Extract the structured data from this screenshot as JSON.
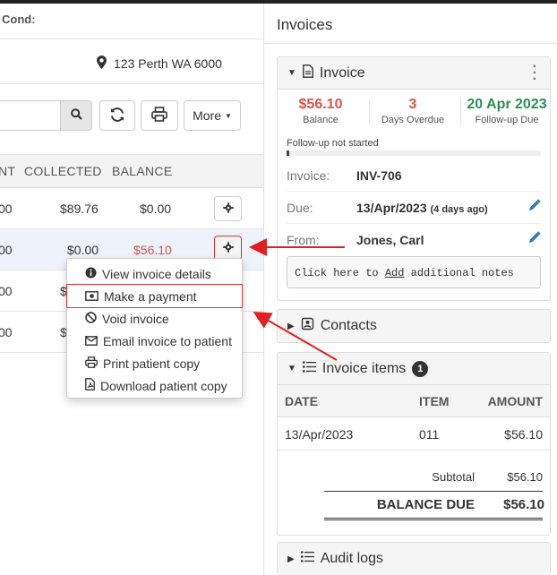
{
  "left": {
    "header_label": "Cond:",
    "address": "123 Perth WA 6000",
    "more_label": "More",
    "columns": [
      "NT",
      "COLLECTED",
      "BALANCE"
    ],
    "rows": [
      {
        "amount": "00",
        "collected": "$89.76",
        "balance": "$0.00"
      },
      {
        "amount": "00",
        "collected": "$0.00",
        "balance": "$56.10"
      },
      {
        "amount": "00",
        "collected": "$",
        "balance": ""
      },
      {
        "amount": "00",
        "collected": "$",
        "balance": ""
      }
    ]
  },
  "menu": {
    "items": [
      {
        "label": "View invoice details",
        "icon": "info-circle-icon"
      },
      {
        "label": "Make a payment",
        "icon": "money-icon"
      },
      {
        "label": "Void invoice",
        "icon": "ban-icon"
      },
      {
        "label": "Email invoice to patient",
        "icon": "envelope-icon"
      },
      {
        "label": "Print patient copy",
        "icon": "print-icon"
      },
      {
        "label": "Download patient copy",
        "icon": "pdf-file-icon"
      }
    ]
  },
  "right": {
    "title": "Invoices",
    "invoice_panel": {
      "title": "Invoice",
      "balance_value": "$56.10",
      "balance_label": "Balance",
      "overdue_value": "3",
      "overdue_label": "Days Overdue",
      "followup_value": "20 Apr 2023",
      "followup_label": "Follow-up Due",
      "followup_status": "Follow-up not started",
      "followup_progress": 0.01,
      "invoice_label": "Invoice:",
      "invoice_value": "INV-706",
      "due_label": "Due:",
      "due_value": "13/Apr/2023",
      "due_note": "(4 days ago)",
      "from_label": "From:",
      "from_value": "Jones, Carl",
      "notes_prefix": "Click here to ",
      "notes_link": "Add",
      "notes_suffix": " additional notes"
    },
    "contacts_title": "Contacts",
    "items_panel": {
      "title": "Invoice items",
      "count": "1",
      "columns": {
        "date": "DATE",
        "item": "ITEM",
        "amount": "AMOUNT"
      },
      "row": {
        "date": "13/Apr/2023",
        "item": "011",
        "amount": "$56.10"
      },
      "subtotal_label": "Subtotal",
      "subtotal_value": "$56.10",
      "balance_due_label": "BALANCE DUE",
      "balance_due_value": "$56.10"
    },
    "audit_title": "Audit logs"
  },
  "colors": {
    "red": "#d9534f",
    "green": "#2e8b57",
    "accent_blue": "#337ab7",
    "annotation_red": "#e02020"
  }
}
